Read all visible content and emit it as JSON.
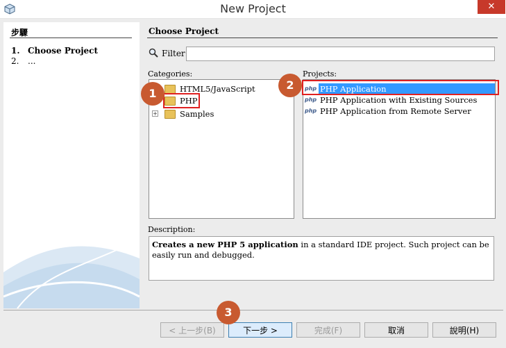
{
  "window": {
    "title": "New Project",
    "close_label": "✕"
  },
  "steps": {
    "title": "步驟",
    "items": [
      {
        "num": "1.",
        "label": "Choose Project"
      },
      {
        "num": "2.",
        "label": "..."
      }
    ]
  },
  "panel": {
    "title": "Choose Project"
  },
  "filter": {
    "label": "Filter:",
    "value": ""
  },
  "categories": {
    "label": "Categories:",
    "items": [
      "HTML5/JavaScript",
      "PHP",
      "Samples"
    ],
    "selected": "PHP"
  },
  "projects": {
    "label": "Projects:",
    "items": [
      "PHP Application",
      "PHP Application with Existing Sources",
      "PHP Application from Remote Server"
    ],
    "selected": "PHP Application"
  },
  "description": {
    "label": "Description:",
    "bold": "Creates a new PHP 5 application",
    "rest": " in a standard IDE project. Such project can be easily run and debugged."
  },
  "badges": [
    "1",
    "2",
    "3"
  ],
  "buttons": {
    "back": "< 上一步(B)",
    "next": "下一步 >",
    "finish": "完成(F)",
    "cancel": "取消",
    "help": "說明(H)"
  },
  "icons": {
    "search": "magnifier-icon",
    "folder": "folder-icon",
    "php": "php-icon",
    "app": "netbeans-cube-icon"
  },
  "colors": {
    "selection": "#3399ff",
    "highlight_box": "#e02020",
    "badge": "#c85a30",
    "close": "#c7392a"
  }
}
